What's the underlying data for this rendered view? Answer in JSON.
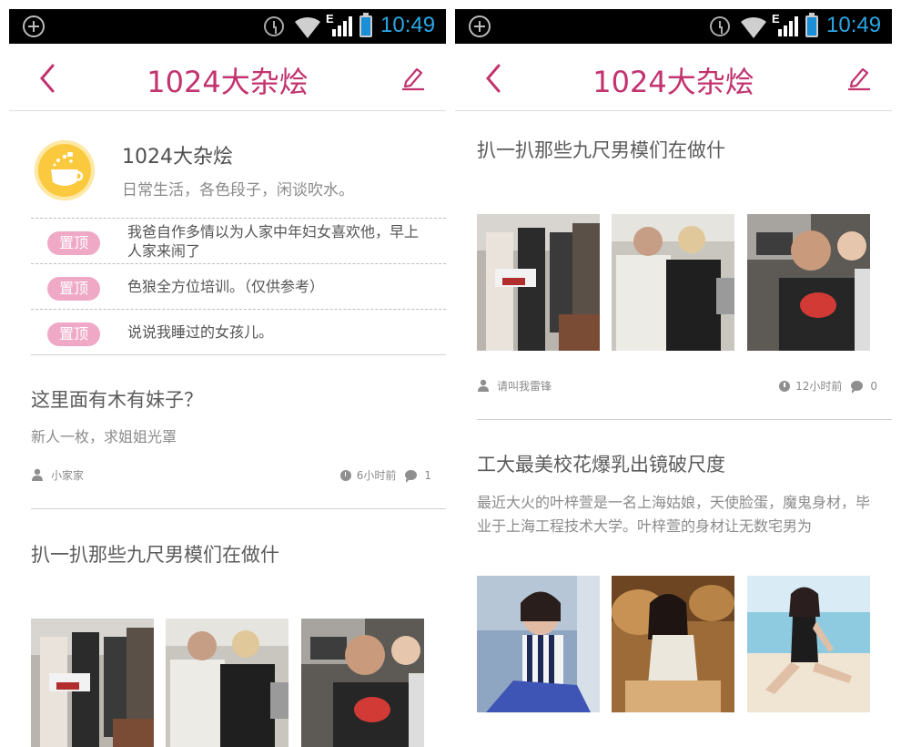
{
  "colors": {
    "accent": "#c2336f",
    "badge": "#efa9c7",
    "time": "#2aa7e3",
    "logo": "#fbc93d"
  },
  "status_bar": {
    "time": "10:49",
    "network": "E",
    "icons": [
      "plus-circle-icon",
      "alarm-icon",
      "wifi-icon",
      "signal-icon",
      "battery-icon"
    ]
  },
  "appbar": {
    "title": "1024大杂烩",
    "back_icon": "chevron-left-icon",
    "edit_icon": "edit-pencil-icon"
  },
  "board": {
    "name": "1024大杂烩",
    "description": "日常生活，各色段子，闲谈吹水。",
    "logo_icon": "tea-cup-icon"
  },
  "pinned": [
    {
      "badge": "置顶",
      "text": "我爸自作多情以为人家中年妇女喜欢他，早上人家来闹了"
    },
    {
      "badge": "置顶",
      "text": "色狼全方位培训。（仅供参考）"
    },
    {
      "badge": "置顶",
      "text": "说说我睡过的女孩儿。"
    }
  ],
  "posts": [
    {
      "title": "这里面有木有妹子？",
      "excerpt": "新人一枚，求姐姐光罩",
      "author": "小家家",
      "time": "6小时前",
      "comments": "1"
    },
    {
      "title": "扒一扒那些九尺男模们在做什",
      "excerpt": "",
      "author": "请叫我雷锋",
      "time": "12小时前",
      "comments": "0",
      "images": [
        "photo-models-group",
        "photo-models-pair",
        "photo-models-kiss"
      ]
    },
    {
      "title": "工大最美校花爆乳出镜破尺度",
      "excerpt": "最近大火的叶梓萱是一名上海姑娘，天使脸蛋，魔鬼身材，毕业于上海工程技术大学。叶梓萱的身材让无数宅男为",
      "images": [
        "photo-girl-striped",
        "photo-girl-rocks",
        "photo-girl-beach"
      ]
    }
  ]
}
